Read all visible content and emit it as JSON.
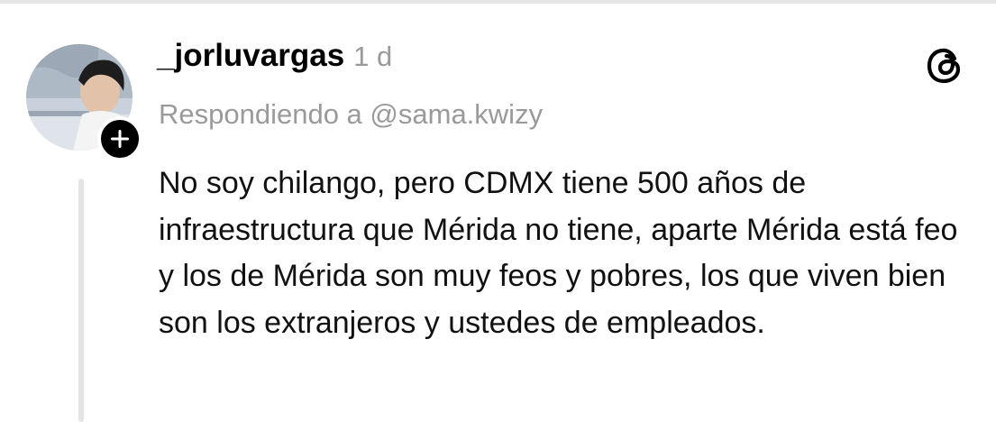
{
  "post": {
    "username": "_jorluvargas",
    "timestamp": "1 d",
    "reply_to": "Respondiendo a @sama.kwizy",
    "text": "No soy chilango, pero CDMX tiene 500 años de infraestructura que Mérida no tiene, aparte Mérida está feo y los de Mérida son muy feos y pobres, los que viven bien son los extranjeros y ustedes de empleados.",
    "avatar_icon": "profile-photo",
    "follow_icon": "plus-icon",
    "app_icon": "threads-logo-icon"
  },
  "colors": {
    "text": "#111111",
    "muted": "#9a9a9a",
    "badge": "#000000",
    "thread_line": "#e4e4e4"
  }
}
